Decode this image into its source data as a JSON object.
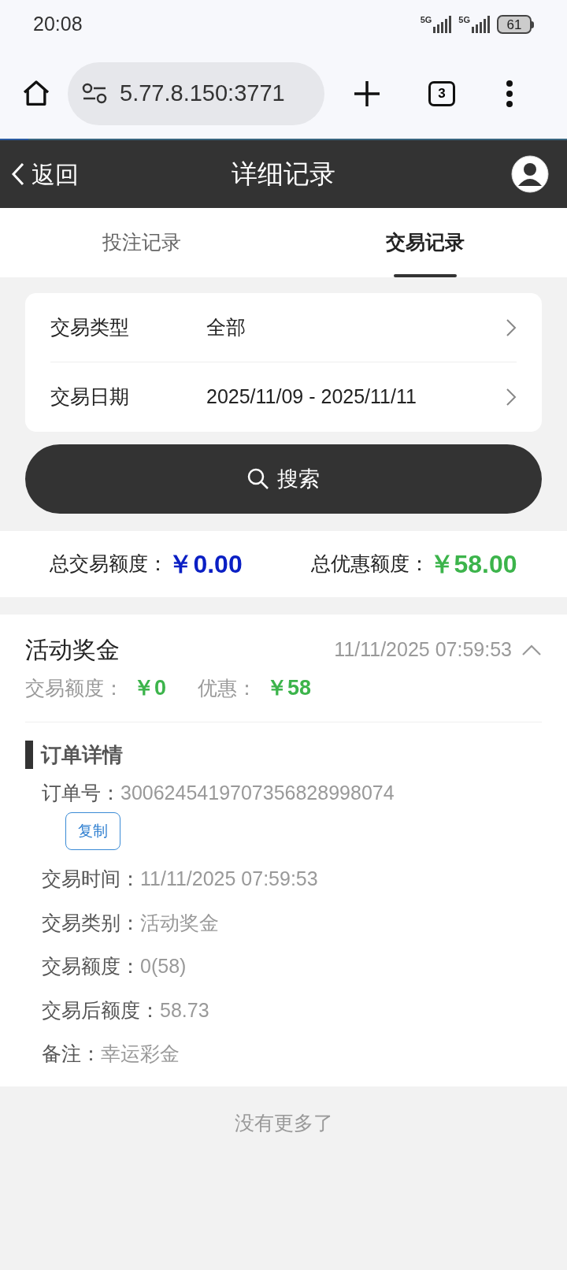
{
  "status_bar": {
    "time": "20:08",
    "network_1": "5G",
    "network_2": "5G",
    "battery": "61"
  },
  "browser": {
    "url": "5.77.8.150:3771",
    "tab_count": "3"
  },
  "header": {
    "back": "返回",
    "title": "详细记录"
  },
  "tabs": [
    {
      "label": "投注记录",
      "selected": false
    },
    {
      "label": "交易记录",
      "selected": true
    }
  ],
  "filters": [
    {
      "label": "交易类型",
      "value": "全部"
    },
    {
      "label": "交易日期",
      "value": "2025/11/09 - 2025/11/11"
    }
  ],
  "search_button": "搜索",
  "totals": [
    {
      "label": "总交易额度：",
      "value": "￥0.00",
      "color": "#0a1fc4"
    },
    {
      "label": "总优惠额度：",
      "value": "￥58.00",
      "color": "#3cb44b"
    }
  ],
  "records": [
    {
      "title": "活动奖金",
      "time": "11/11/2025 07:59:53",
      "expanded": true,
      "amount_label": "交易额度：",
      "amount": "￥0",
      "bonus_label": "优惠：",
      "bonus": "￥58",
      "details_title": "订单详情",
      "order_label": "订单号：",
      "order_no": "3006245419707356828998074",
      "copy_button": "复制",
      "details": [
        {
          "label": "交易时间：",
          "value": "11/11/2025 07:59:53"
        },
        {
          "label": "交易类别：",
          "value": "活动奖金"
        },
        {
          "label": "交易额度：",
          "value": "0(58)"
        },
        {
          "label": "交易后额度：",
          "value": "58.73"
        },
        {
          "label": "备注：",
          "value": "幸运彩金"
        }
      ]
    }
  ],
  "footer": "没有更多了"
}
